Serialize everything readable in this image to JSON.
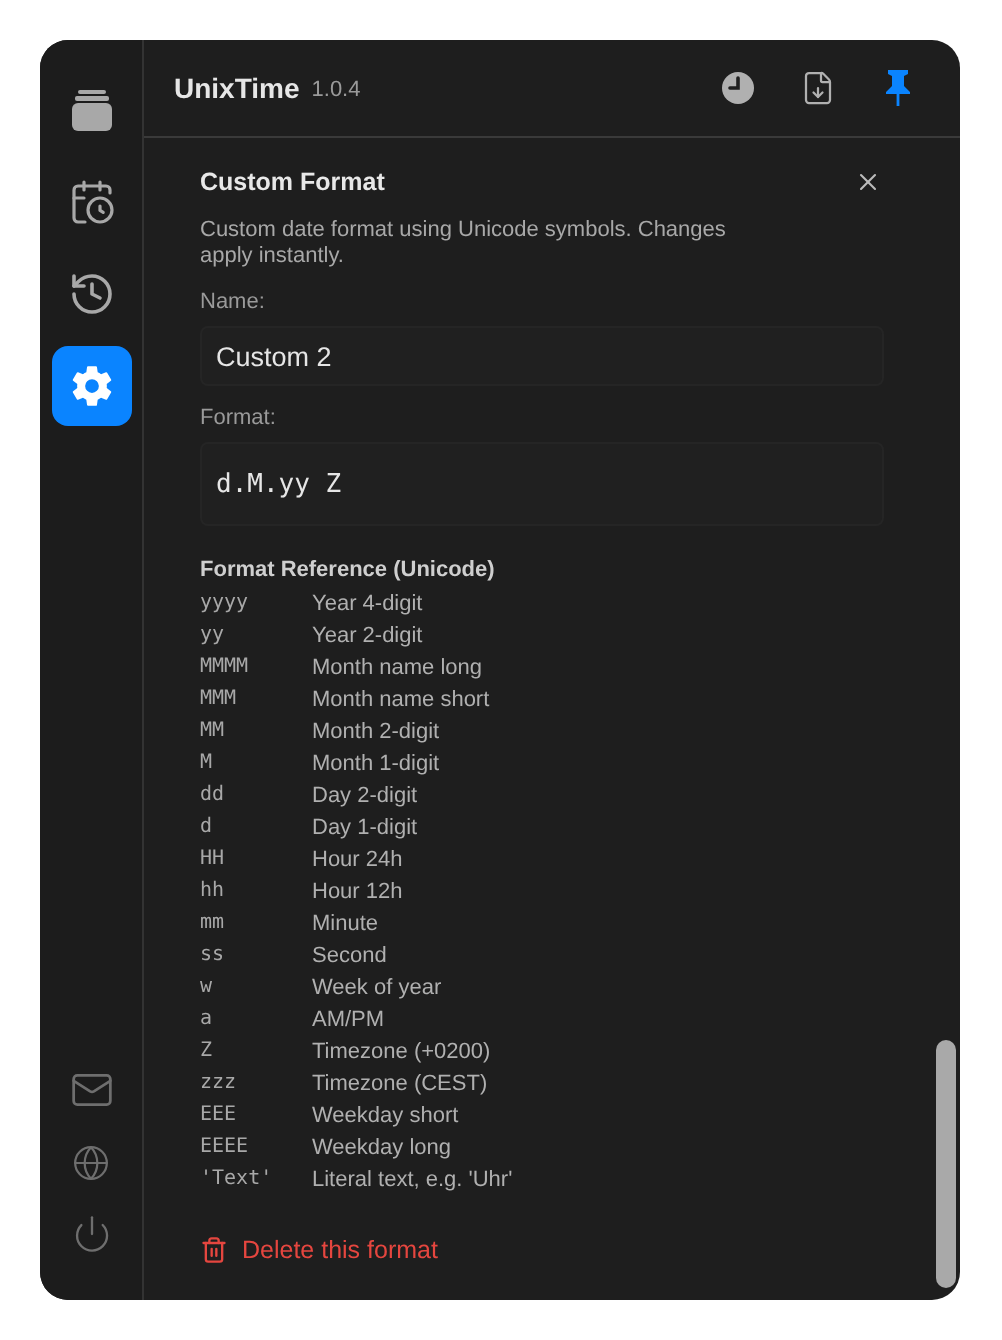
{
  "sidebar": {
    "items": [
      {
        "kind": "stack",
        "selected": false
      },
      {
        "kind": "calendar",
        "selected": false
      },
      {
        "kind": "history",
        "selected": false
      },
      {
        "kind": "settings",
        "selected": true
      }
    ],
    "footer_items": [
      {
        "kind": "mail"
      },
      {
        "kind": "globe"
      },
      {
        "kind": "power"
      }
    ]
  },
  "header": {
    "title": "UnixTime",
    "version": "1.0.4",
    "actions": [
      {
        "kind": "clock",
        "active": false
      },
      {
        "kind": "export",
        "active": false
      },
      {
        "kind": "pin",
        "active": true
      }
    ]
  },
  "panel": {
    "title": "Custom Format",
    "description": "Custom date format using Unicode symbols. Changes apply instantly.",
    "name_label": "Name:",
    "name_value": "Custom 2",
    "format_label": "Format:",
    "format_value": "d.M.yy Z",
    "reference_title": "Format Reference (Unicode)",
    "reference": [
      {
        "symbol": "yyyy",
        "meaning": "Year 4-digit"
      },
      {
        "symbol": "yy",
        "meaning": "Year 2-digit"
      },
      {
        "symbol": "MMMM",
        "meaning": "Month name long"
      },
      {
        "symbol": "MMM",
        "meaning": "Month name short"
      },
      {
        "symbol": "MM",
        "meaning": "Month 2-digit"
      },
      {
        "symbol": "M",
        "meaning": "Month 1-digit"
      },
      {
        "symbol": "dd",
        "meaning": "Day 2-digit"
      },
      {
        "symbol": "d",
        "meaning": "Day 1-digit"
      },
      {
        "symbol": "HH",
        "meaning": "Hour 24h"
      },
      {
        "symbol": "hh",
        "meaning": "Hour 12h"
      },
      {
        "symbol": "mm",
        "meaning": "Minute"
      },
      {
        "symbol": "ss",
        "meaning": "Second"
      },
      {
        "symbol": "w",
        "meaning": "Week of year"
      },
      {
        "symbol": "a",
        "meaning": "AM/PM"
      },
      {
        "symbol": "Z",
        "meaning": "Timezone (+0200)"
      },
      {
        "symbol": "zzz",
        "meaning": "Timezone (CEST)"
      },
      {
        "symbol": "EEE",
        "meaning": "Weekday short"
      },
      {
        "symbol": "EEEE",
        "meaning": "Weekday long"
      },
      {
        "symbol": "'Text'",
        "meaning": "Literal text, e.g. 'Uhr'"
      }
    ],
    "delete_label": "Delete this format"
  }
}
